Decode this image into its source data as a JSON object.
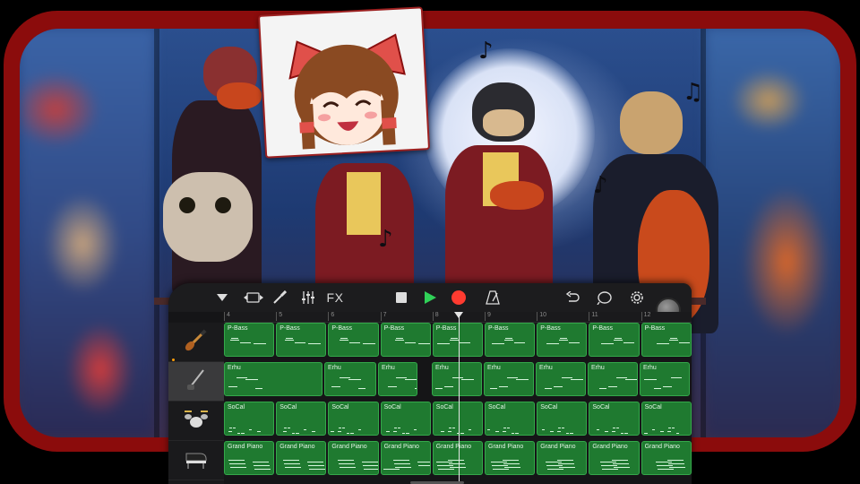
{
  "toolbar": {
    "fx_label": "FX",
    "icons": [
      "tracks-dropdown-icon",
      "track-view-icon",
      "brush-icon",
      "mixer-icon",
      "stop-icon",
      "play-icon",
      "record-icon",
      "metronome-icon",
      "undo-icon",
      "loop-icon",
      "settings-icon"
    ]
  },
  "ruler": {
    "bars": [
      "4",
      "5",
      "6",
      "7",
      "8",
      "9",
      "10",
      "11",
      "12"
    ]
  },
  "tracks": [
    {
      "instrument": "P-Bass",
      "icon": "bass-guitar-icon"
    },
    {
      "instrument": "Erhu",
      "icon": "erhu-icon"
    },
    {
      "instrument": "SoCal",
      "icon": "drum-kit-icon"
    },
    {
      "instrument": "Grand Piano",
      "icon": "grand-piano-icon"
    }
  ],
  "regions": {
    "bass": [
      "P-Bass",
      "P-Bass",
      "P-Bass",
      "P-Bass",
      "P-Bass",
      "P-Bass",
      "P-Bass",
      "P-Bass",
      "P-Bass"
    ],
    "erhu": [
      "Erhu",
      "Erhu",
      "Erhu",
      "Erhu",
      "Erhu",
      "Erhu",
      "Erhu",
      "Erhu"
    ],
    "drums": [
      "SoCal",
      "SoCal",
      "SoCal",
      "SoCal",
      "SoCal",
      "SoCal",
      "SoCal",
      "SoCal",
      "SoCal"
    ],
    "piano": [
      "Grand Piano",
      "Grand Piano",
      "Grand Piano",
      "Grand Piano",
      "Grand Piano",
      "Grand Piano",
      "Grand Piano",
      "Grand Piano",
      "Grand Piano"
    ]
  },
  "colors": {
    "frame": "#8b0c0c",
    "region_fill": "#1f7a30",
    "region_border": "#34a84a",
    "play": "#30d158",
    "record": "#ff3b30"
  }
}
